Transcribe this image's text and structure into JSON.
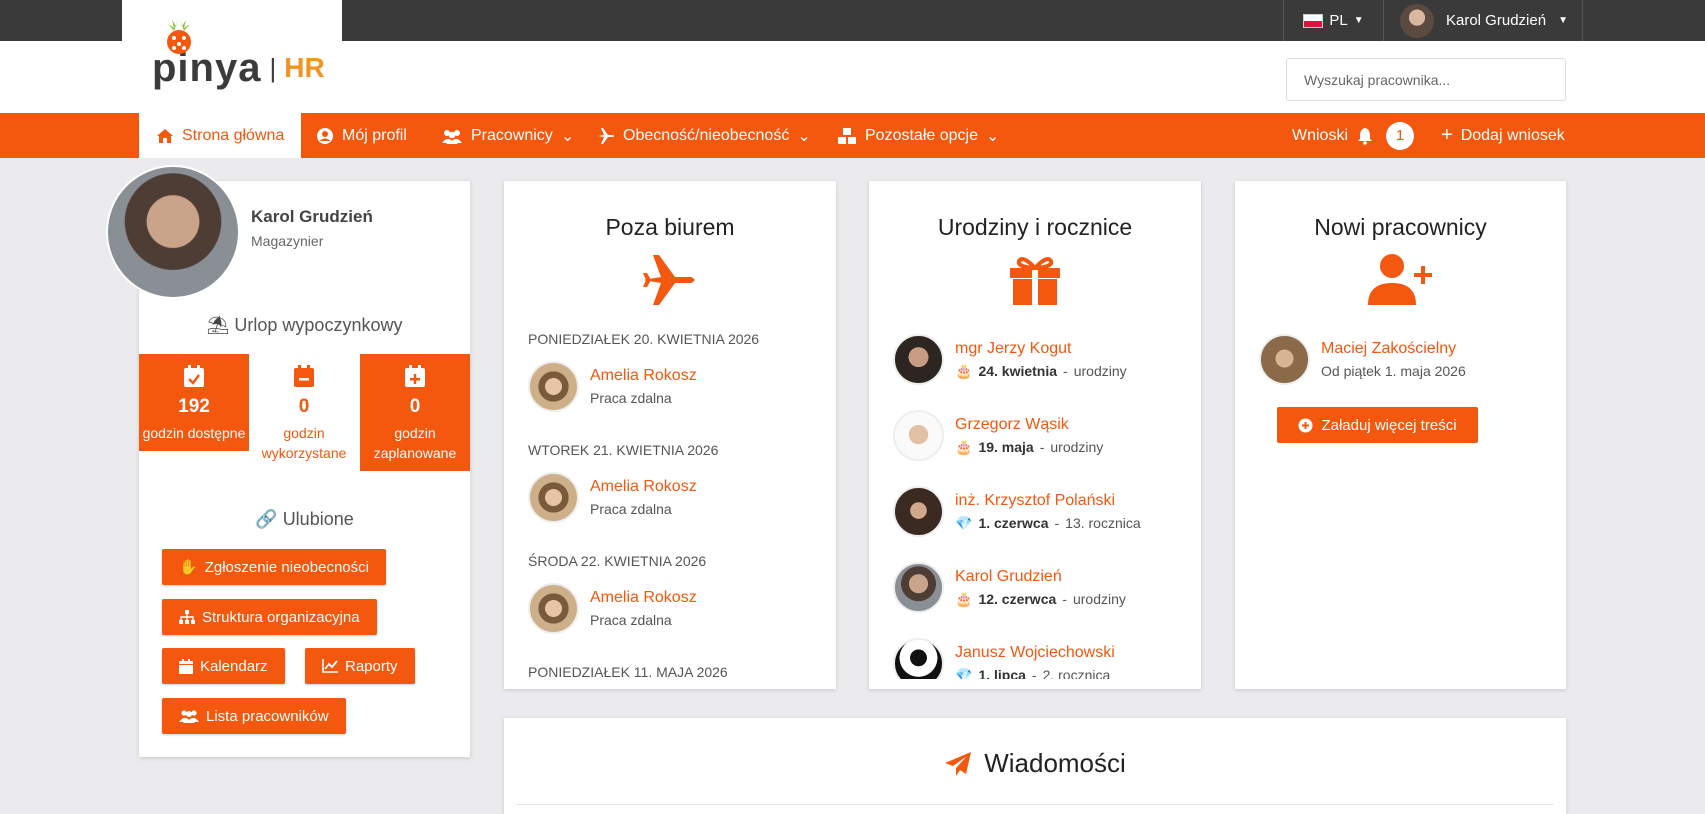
{
  "top_bar": {
    "language": "PL",
    "user_name": "Karol Grudzień"
  },
  "logo": {
    "word": "pinya",
    "separator": "|",
    "product": "HR"
  },
  "search": {
    "placeholder": "Wyszukaj pracownika..."
  },
  "nav": {
    "items": [
      {
        "label": "Strona główna",
        "icon": "home-icon",
        "active": true
      },
      {
        "label": "Mój profil",
        "icon": "user-circle-icon"
      },
      {
        "label": "Pracownicy",
        "icon": "users-icon",
        "dropdown": true
      },
      {
        "label": "Obecność/nieobecność",
        "icon": "plane-icon",
        "dropdown": true
      },
      {
        "label": "Pozostałe opcje",
        "icon": "cubes-icon",
        "dropdown": true
      }
    ],
    "requests_label": "Wnioski",
    "requests_count": "1",
    "add_request_label": "Dodaj wniosek"
  },
  "profile": {
    "name": "Karol Grudzień",
    "role": "Magazynier",
    "leave_type": "Urlop wypoczynkowy",
    "stats": [
      {
        "value": "192",
        "label": "godzin dostępne"
      },
      {
        "value": "0",
        "label": "godzin wykorzystane"
      },
      {
        "value": "0",
        "label": "godzin zaplanowane"
      }
    ],
    "favorites_title": "Ulubione",
    "favorites": [
      "Zgłoszenie nieobecności",
      "Struktura organizacyjna",
      "Kalendarz",
      "Raporty",
      "Lista pracowników"
    ]
  },
  "out_of_office": {
    "title": "Poza biurem",
    "days": [
      {
        "date": "PONIEDZIAŁEK 20. KWIETNIA 2026",
        "person": "Amelia Rokosz",
        "status": "Praca zdalna"
      },
      {
        "date": "WTOREK 21. KWIETNIA 2026",
        "person": "Amelia Rokosz",
        "status": "Praca zdalna"
      },
      {
        "date": "ŚRODA 22. KWIETNIA 2026",
        "person": "Amelia Rokosz",
        "status": "Praca zdalna"
      },
      {
        "date": "PONIEDZIAŁEK 11. MAJA 2026",
        "person": "",
        "status": ""
      }
    ]
  },
  "birthdays": {
    "title": "Urodziny i rocznice",
    "items": [
      {
        "name": "mgr Jerzy Kogut",
        "date": "24. kwietnia",
        "event": "urodziny",
        "kind": "birthday"
      },
      {
        "name": "Grzegorz Wąsik",
        "date": "19. maja",
        "event": "urodziny",
        "kind": "birthday"
      },
      {
        "name": "inż. Krzysztof Polański",
        "date": "1. czerwca",
        "event": "13. rocznica",
        "kind": "anniversary"
      },
      {
        "name": "Karol Grudzień",
        "date": "12. czerwca",
        "event": "urodziny",
        "kind": "birthday"
      },
      {
        "name": "Janusz Wojciechowski",
        "date": "1. lipca",
        "event": "2. rocznica",
        "kind": "anniversary"
      }
    ]
  },
  "new_employees": {
    "title": "Nowi pracownicy",
    "items": [
      {
        "name": "Maciej Zakościelny",
        "since": "Od piątek 1. maja 2026"
      }
    ],
    "load_more_label": "Załaduj więcej treści"
  },
  "messages": {
    "title": "Wiadomości"
  },
  "colors": {
    "accent": "#f4570e",
    "topbar": "#3a3a3a",
    "background": "#ebebed"
  }
}
